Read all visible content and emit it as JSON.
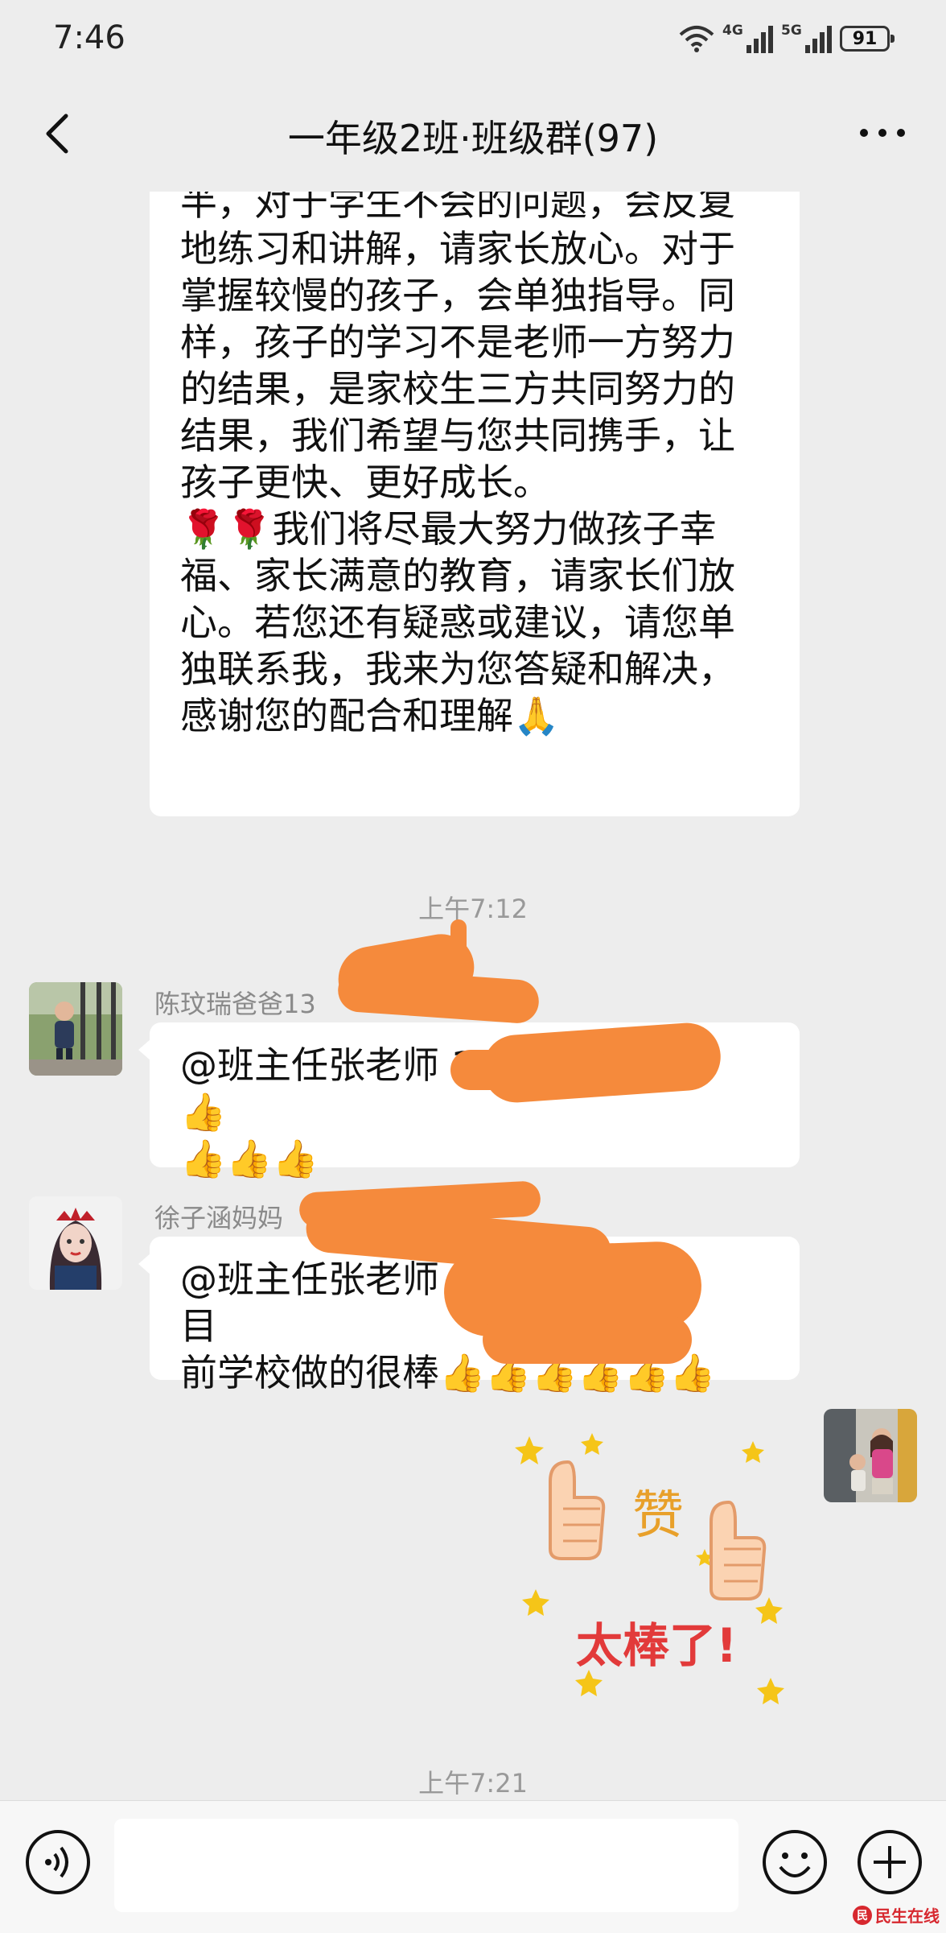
{
  "status_bar": {
    "time": "7:46",
    "net1": "4G",
    "net2": "5G",
    "battery": "91"
  },
  "header": {
    "title": "一年级2班·班级群(97)"
  },
  "messages": {
    "teacher_text": "半，对于学生不会的问题，会反复\n地练习和讲解，请家长放心。对于\n掌握较慢的孩子，会单独指导。同\n样，孩子的学习不是老师一方努力\n的结果，是家校生三方共同努力的\n结果，我们希望与您共同携手，让\n孩子更快、更好成长。\n🌹🌹我们将尽最大努力做孩子幸\n福、家长满意的教育，请家长们放\n心。若您还有疑惑或建议，请您单\n独联系我，我来为您答疑和解决，\n感谢您的配合和理解🙏",
    "time1": "上午7:12",
    "msg1_sender": "陈玟瑞爸爸13",
    "msg1_text": "@班主任张老师 1                          👍\n👍👍👍",
    "msg2_sender": "徐子涵妈妈",
    "msg2_text": "@班主任张老师 1                          目\n前学校做的很棒👍👍👍👍👍👍",
    "sticker": {
      "top": "赞",
      "bottom": "太棒了!"
    },
    "time2": "上午7:21"
  },
  "watermark": {
    "text": "民生在线"
  },
  "colors": {
    "background": "#ededed",
    "bubble": "#ffffff",
    "redaction": "#f58a3c"
  }
}
